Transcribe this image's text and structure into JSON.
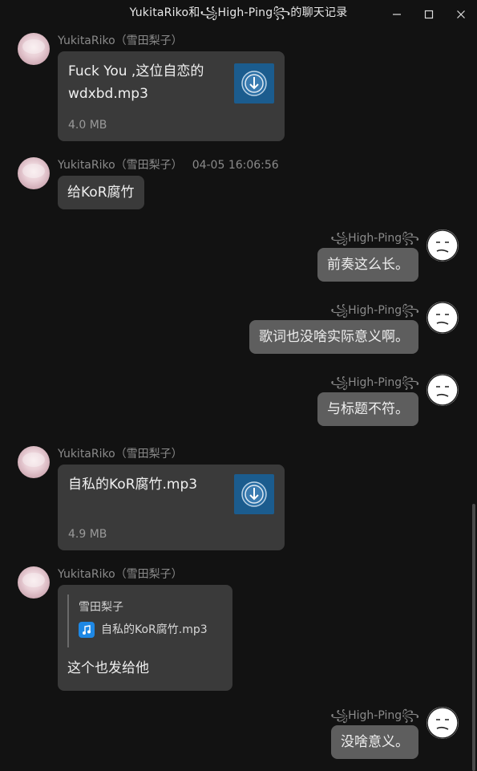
{
  "window": {
    "title": "YukitaRiko和꧁High-Ping꧂的聊天记录",
    "minimize": "—",
    "maximize": "□",
    "close": "✕"
  },
  "messages": [
    {
      "sender": "YukitaRiko（雪田梨子）",
      "file_name": "Fuck You ,这位自恋的wdxbd.mp3",
      "file_size": "4.0 MB"
    },
    {
      "sender": "YukitaRiko（雪田梨子）",
      "time": "04-05 16:06:56",
      "text": "给KoR腐竹"
    },
    {
      "sender": "꧁High-Ping꧂",
      "text": "前奏这么长。"
    },
    {
      "sender": "꧁High-Ping꧂",
      "text": "歌词也没啥实际意义啊。"
    },
    {
      "sender": "꧁High-Ping꧂",
      "text": "与标题不符。"
    },
    {
      "sender": "YukitaRiko（雪田梨子）",
      "file_name": "自私的KoR腐竹.mp3",
      "file_size": "4.9 MB"
    },
    {
      "sender": "YukitaRiko（雪田梨子）",
      "quote_name": "雪田梨子",
      "quote_file": "自私的KoR腐竹.mp3",
      "text": "这个也发给他"
    },
    {
      "sender": "꧁High-Ping꧂",
      "text": "没啥意义。"
    }
  ]
}
